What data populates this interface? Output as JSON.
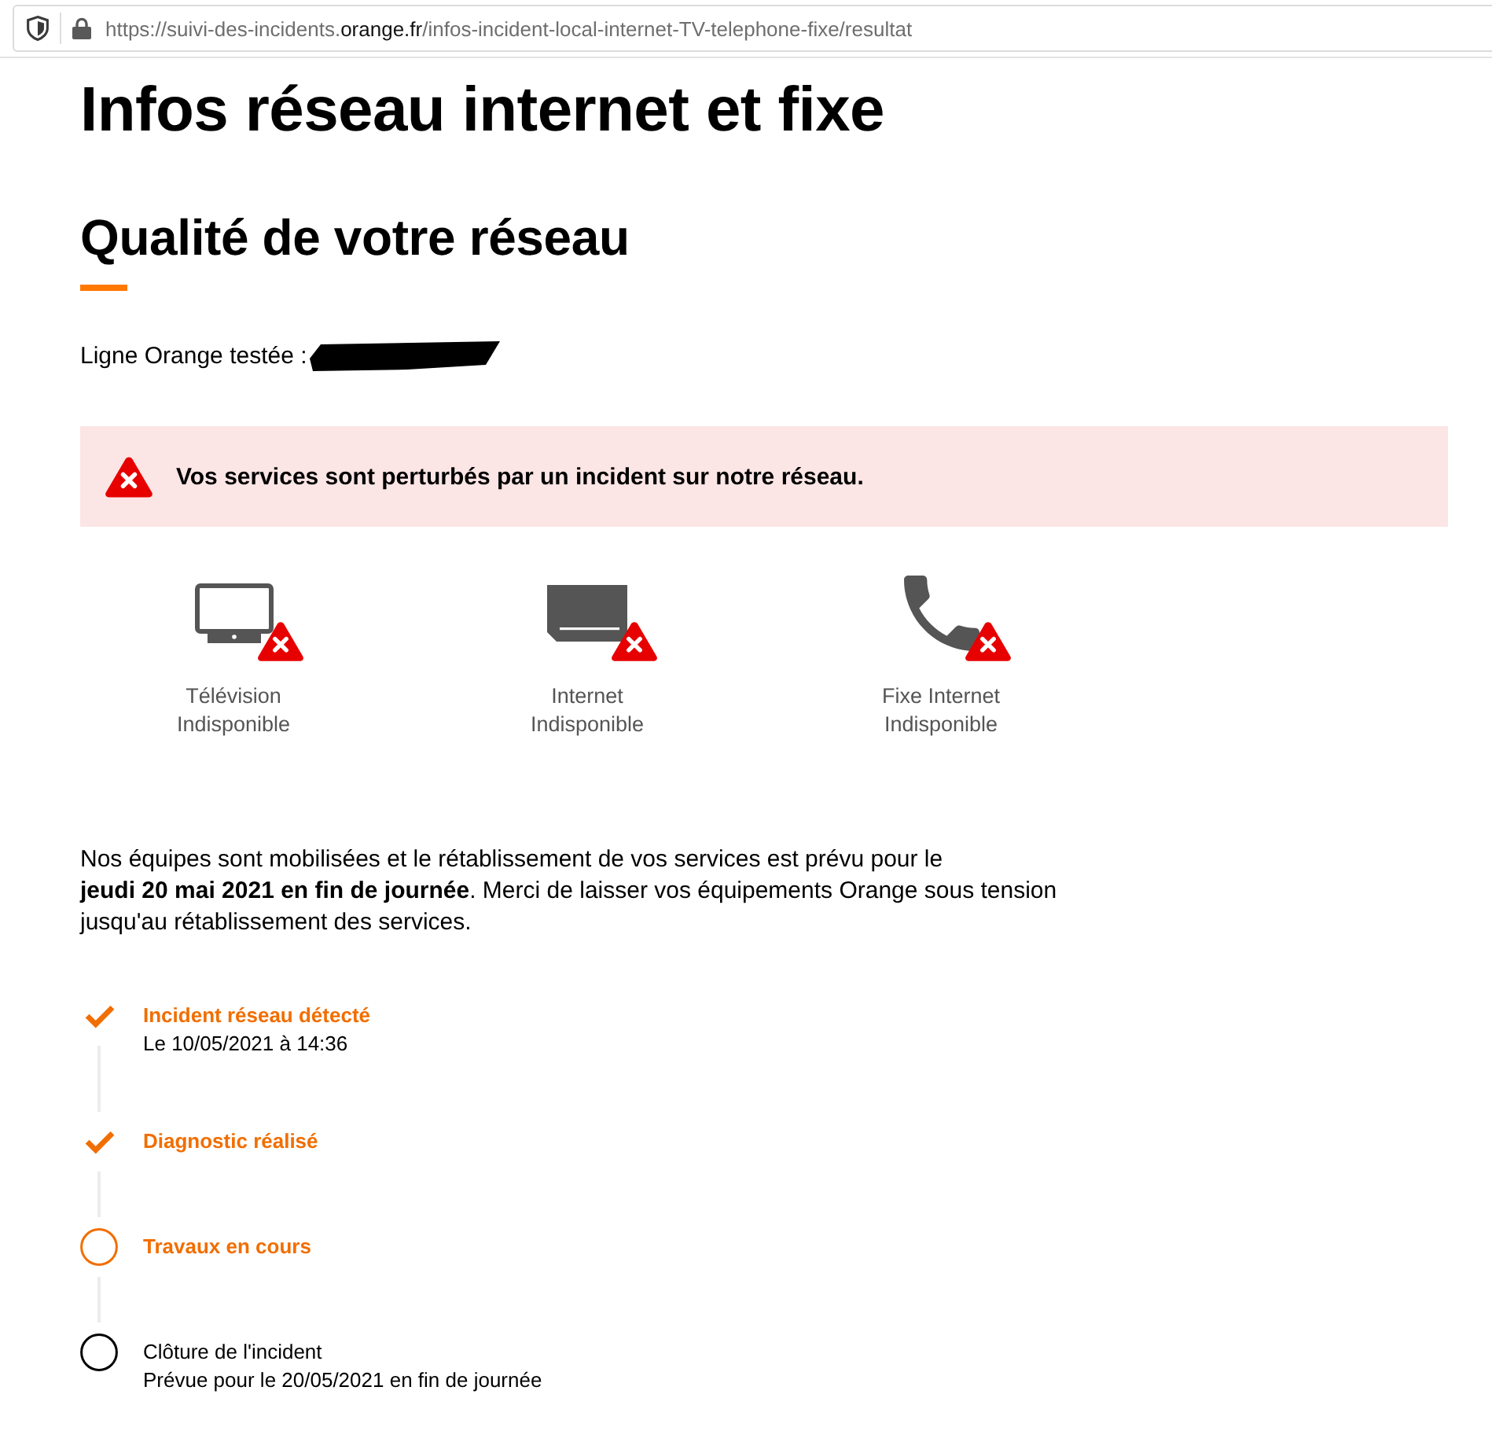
{
  "browser": {
    "url": {
      "host_prefix": "https://suivi-des-incidents.",
      "domain": "orange.fr",
      "path": "/infos-incident-local-internet-TV-telephone-fixe/resultat"
    }
  },
  "page": {
    "title": "Infos réseau internet et fixe",
    "section_title": "Qualité de votre réseau",
    "tested_line_label": "Ligne Orange testée :"
  },
  "alert": {
    "message": "Vos services sont perturbés par un incident sur notre réseau."
  },
  "services": [
    {
      "kind": "tv",
      "name": "Télévision",
      "status": "Indisponible",
      "available": false
    },
    {
      "kind": "internet",
      "name": "Internet",
      "status": "Indisponible",
      "available": false
    },
    {
      "kind": "phone",
      "name": "Fixe Internet",
      "status": "Indisponible",
      "available": false
    }
  ],
  "message_lines": [
    "Nos équipes sont mobilisées et le rétablissement de vos services est prévu pour le",
    "**jeudi 20 mai 2021 en fin de journée**. Merci de laisser vos équipements Orange sous tension jusqu'au rétablissement des services."
  ],
  "timeline": [
    {
      "kind": "done",
      "title": "Incident réseau détecté",
      "detail": "Le 10/05/2021 à 14:36"
    },
    {
      "kind": "done",
      "title": "Diagnostic réalisé"
    },
    {
      "kind": "current",
      "title": "Travaux en cours"
    },
    {
      "kind": "pending",
      "title": "Clôture de l'incident",
      "detail": "Prévue pour le 20/05/2021 en fin de journée"
    }
  ]
}
